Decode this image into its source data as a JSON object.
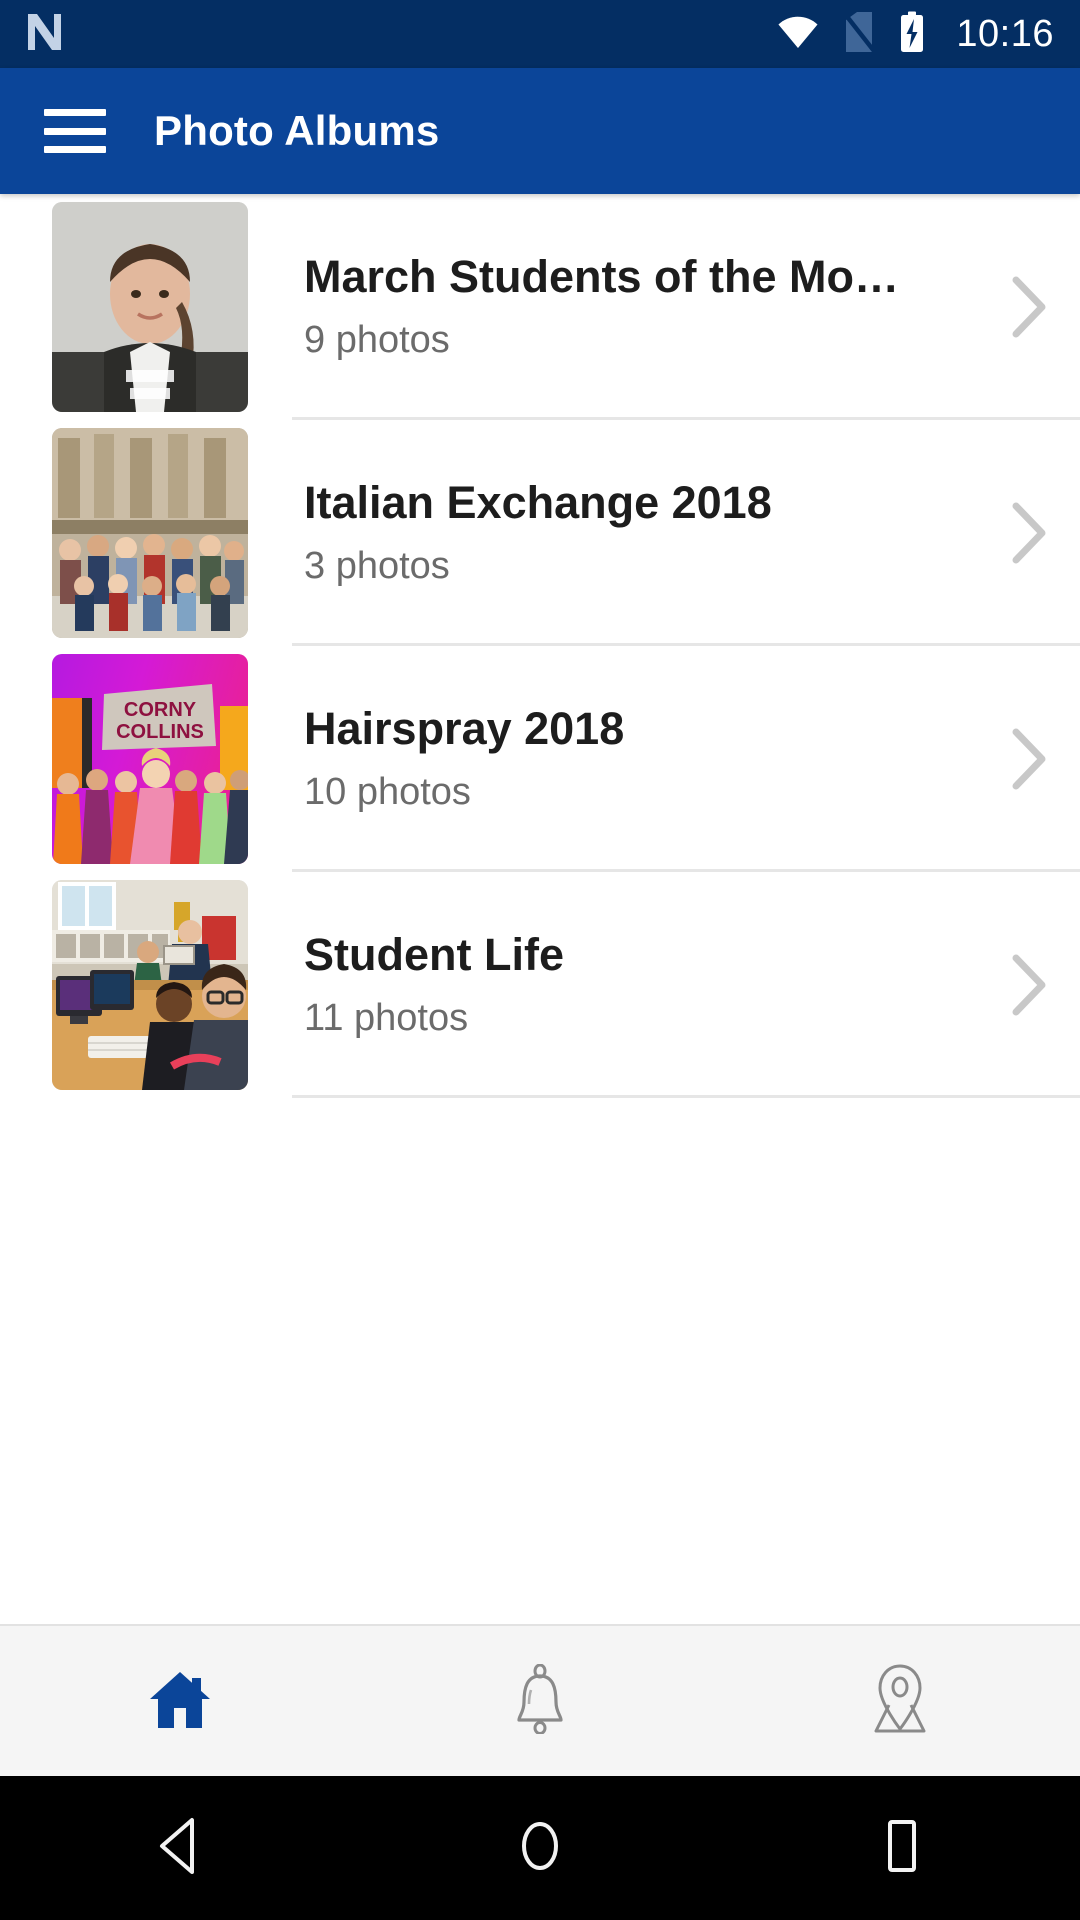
{
  "status_bar": {
    "app_badge_icon": "app-logo-n-icon",
    "wifi_icon": "wifi-icon",
    "sim_icon": "no-sim-card-icon",
    "battery_icon": "battery-charging-icon",
    "time": "10:16",
    "background_color": "#042e63"
  },
  "app_bar": {
    "menu_icon": "hamburger-menu-icon",
    "title": "Photo Albums",
    "background_color": "#0b4599"
  },
  "albums": [
    {
      "title": "March Students of the Mo…",
      "count_label": "9 photos",
      "thumbnail": "student-portrait-thumbnail",
      "chevron_icon": "chevron-right-icon"
    },
    {
      "title": "Italian Exchange 2018",
      "count_label": "3 photos",
      "thumbnail": "group-photo-piazza-thumbnail",
      "chevron_icon": "chevron-right-icon"
    },
    {
      "title": "Hairspray 2018",
      "count_label": "10 photos",
      "thumbnail": "hairspray-stage-thumbnail",
      "chevron_icon": "chevron-right-icon"
    },
    {
      "title": "Student Life",
      "count_label": "11 photos",
      "thumbnail": "computer-lab-classroom-thumbnail",
      "chevron_icon": "chevron-right-icon"
    }
  ],
  "tab_bar": {
    "background_color": "#f5f5f5",
    "active_color": "#0b4599",
    "inactive_color": "#8a8a8a",
    "items": [
      {
        "icon": "home-icon",
        "active": true
      },
      {
        "icon": "bell-icon",
        "active": false
      },
      {
        "icon": "map-pin-icon",
        "active": false
      }
    ]
  },
  "nav_bar": {
    "background_color": "#000000",
    "items": [
      {
        "icon": "back-triangle-icon"
      },
      {
        "icon": "home-circle-icon"
      },
      {
        "icon": "recents-square-icon"
      }
    ]
  }
}
